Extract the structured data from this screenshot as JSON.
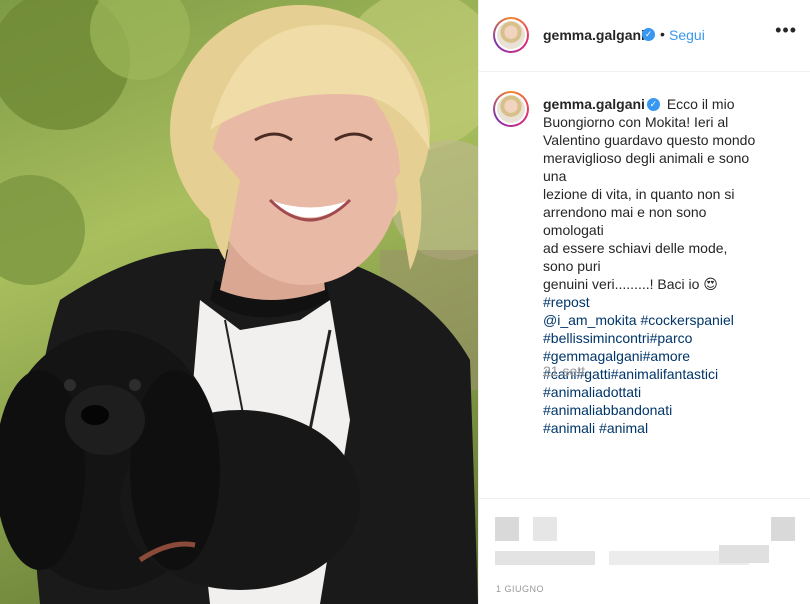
{
  "post": {
    "username": "gemma.galgani",
    "follow_label": "Segui",
    "separator": "•",
    "more_label": "•••",
    "verified_glyph": "✓"
  },
  "caption": {
    "username": "gemma.galgani",
    "lines": [
      "Ecco il mio",
      "Buongiorno con Mokita! Ieri al",
      "Valentino guardavo questo mondo",
      "meraviglioso degli animali e sono una",
      "lezione di vita, in quanto non si",
      "arrendono mai e non sono omologati",
      "ad essere schiavi delle mode, sono puri",
      "genuini veri.........! Baci io"
    ],
    "emoji": "😍",
    "hashtag_lines": [
      "#repost",
      "@i_am_mokita #cockerspaniel",
      "#bellissimincontri#parco",
      "#gemmagalgani#amore",
      "#cani#gatti#animalifantastici",
      "#animaliadottati #animaliabbandonati",
      "#animali #animal"
    ],
    "date": "21 sett."
  },
  "footer": {
    "date": "1 GIUGNO"
  },
  "colors": {
    "link_blue": "#3897f0",
    "hashtag": "#003569",
    "muted": "#999999"
  }
}
